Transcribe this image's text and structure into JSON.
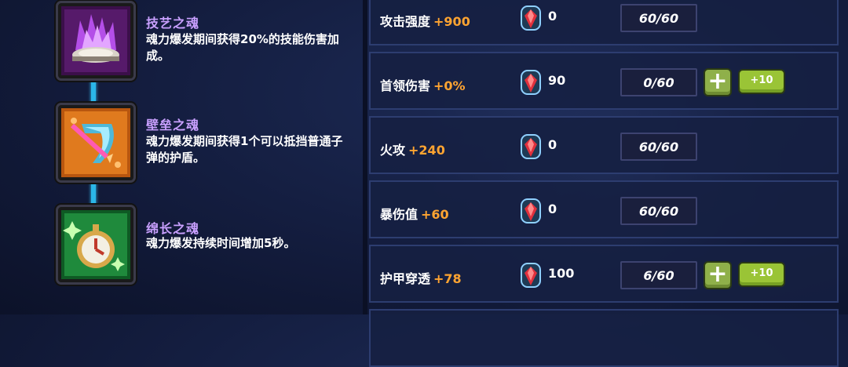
{
  "souls": [
    {
      "name": "技艺之魂",
      "desc": "魂力爆发期间获得20%的技能伤害加成。",
      "icon": "skill-soul-icon"
    },
    {
      "name": "壁垒之魂",
      "desc": "魂力爆发期间获得1个可以抵挡普通子弹的护盾。",
      "icon": "bulwark-soul-icon"
    },
    {
      "name": "绵长之魂",
      "desc": "魂力爆发持续时间增加5秒。",
      "icon": "endurance-soul-icon"
    }
  ],
  "stats": [
    {
      "name": "攻击强度",
      "bonus": "+900",
      "gems": "0",
      "level": "60/60",
      "upgradable": false
    },
    {
      "name": "首领伤害",
      "bonus": "+0%",
      "gems": "90",
      "level": "0/60",
      "upgradable": true
    },
    {
      "name": "火攻",
      "bonus": "+240",
      "gems": "0",
      "level": "60/60",
      "upgradable": false
    },
    {
      "name": "暴伤值",
      "bonus": "+60",
      "gems": "0",
      "level": "60/60",
      "upgradable": false
    },
    {
      "name": "护甲穿透",
      "bonus": "+78",
      "gems": "100",
      "level": "6/60",
      "upgradable": true
    }
  ],
  "buttons": {
    "plus_label": "+",
    "plus10_label": "+10"
  },
  "colors": {
    "soul_name": "#c9a0ff",
    "bonus": "#ffa431",
    "connector": "#2bb6e8",
    "button_green": "#9ac436"
  }
}
